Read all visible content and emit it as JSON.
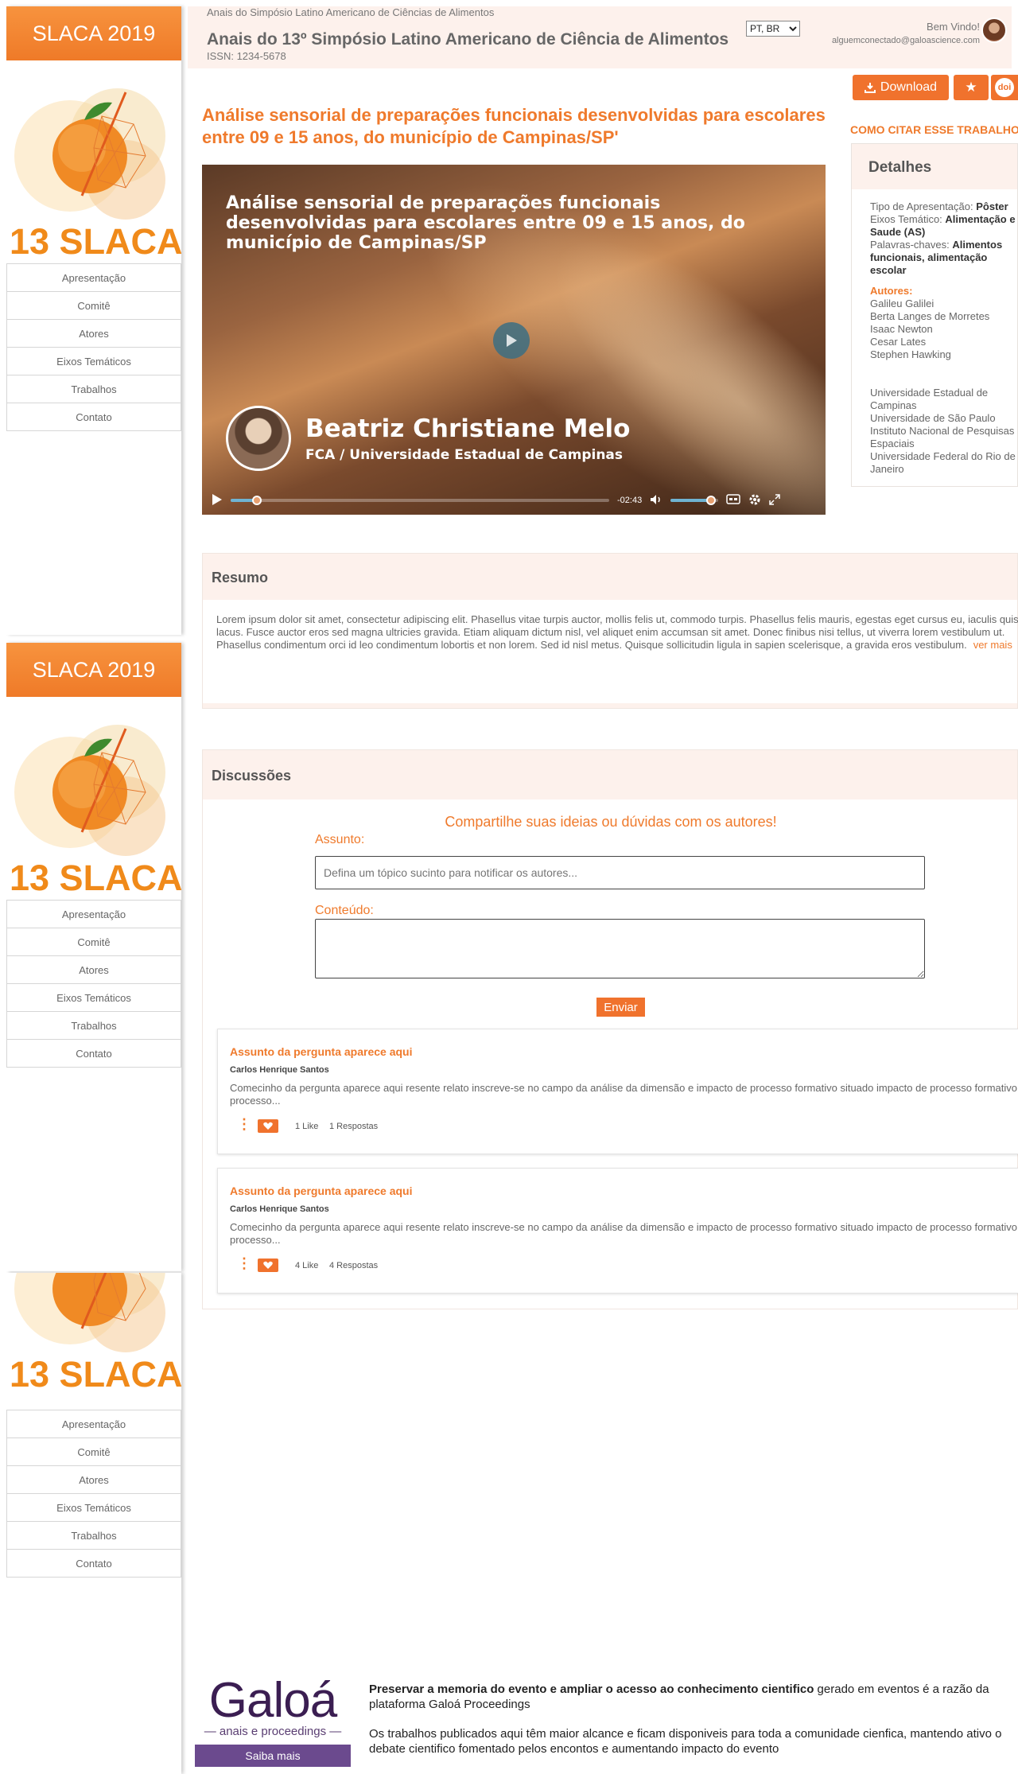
{
  "sidebar": {
    "title": "SLACA 2019",
    "logo_text": "13 SLACA",
    "items": [
      "Apresentação",
      "Comitê",
      "Atores",
      "Eixos Temáticos",
      "Trabalhos",
      "Contato"
    ]
  },
  "header": {
    "subtitle": "Anais do Simpósio Latino Americano de Ciências de Alimentos",
    "title": "Anais do 13º Simpósio Latino Americano de Ciência de Alimentos",
    "issn": "ISSN: 1234-5678",
    "language": "PT, BR",
    "welcome": "Bem Vindo!",
    "email": "alguemconectado@galoascience.com"
  },
  "actions": {
    "download": "Download",
    "doi": "doi"
  },
  "paper": {
    "title": "Análise sensorial de preparações funcionais desenvolvidas para escolares entre 09 e 15 anos, do município de Campinas/SP'",
    "video_title": "Análise sensorial de preparações funcionais desenvolvidas para escolares entre 09 e 15 anos, do município de Campinas/SP",
    "speaker_name": "Beatriz Christiane Melo",
    "speaker_inst": "FCA / Universidade Estadual de Campinas",
    "time_remaining": "-02:43",
    "progress": 0.07,
    "volume": 0.85
  },
  "details": {
    "cite": "COMO CITAR ESSE TRABALHO?",
    "heading": "Detalhes",
    "tipo_label": "Tipo de Apresentação:",
    "tipo_value": "Pôster",
    "eixos_label": "Eixos Temático:",
    "eixos_value": "Alimentação e Saude (AS)",
    "palavras_label": "Palavras-chaves:",
    "palavras_value": "Alimentos funcionais, alimentação escolar",
    "autores_label": "Autores:",
    "autores": [
      "Galileu Galilei",
      "Berta Langes de Morretes",
      "Isaac Newton",
      "Cesar Lates",
      "Stephen Hawking"
    ],
    "instituicoes": [
      "Universidade Estadual de Campinas",
      "Universidade de São Paulo",
      "Instituto Nacional de Pesquisas Espaciais",
      "Universidade Federal do Rio de Janeiro"
    ]
  },
  "resumo": {
    "heading": "Resumo",
    "text": "Lorem ipsum dolor sit amet, consectetur adipiscing elit. Phasellus vitae turpis auctor, mollis felis ut, commodo turpis. Phasellus felis mauris, egestas eget cursus eu, iaculis quis lacus. Fusce auctor eros sed magna ultricies gravida. Etiam aliquam dictum nisl, vel aliquet enim accumsan sit amet. Donec finibus nisi tellus, ut viverra lorem vestibulum ut. Phasellus condimentum orci id leo condimentum lobortis et non lorem. Sed id nisl metus. Quisque sollicitudin ligula in sapien scelerisque, a gravida eros vestibulum.",
    "more": "ver mais"
  },
  "discussoes": {
    "heading": "Discussões",
    "share": "Compartilhe suas ideias ou dúvidas com os autores!",
    "assunto_label": "Assunto:",
    "assunto_placeholder": "Defina um tópico sucinto para notificar os autores...",
    "conteudo_label": "Conteúdo:",
    "send": "Enviar",
    "questions": [
      {
        "subject": "Assunto da pergunta aparece aqui",
        "author": "Carlos Henrique Santos",
        "text": "Comecinho da pergunta aparece aqui resente relato inscreve-se no campo da análise da dimensão e impacto de processo formativo situado impacto de processo formativo processo...",
        "likes": "1 Like",
        "replies": "1 Respostas"
      },
      {
        "subject": "Assunto da pergunta aparece aqui",
        "author": "Carlos Henrique Santos",
        "text": "Comecinho da pergunta aparece aqui resente relato inscreve-se no campo da análise da dimensão e impacto de processo formativo situado impacto de processo formativo processo...",
        "likes": "4 Like",
        "replies": "4 Respostas"
      }
    ]
  },
  "footer": {
    "brand": "Galoá",
    "brand_sub": "anais e proceedings",
    "button": "Saiba mais",
    "p1_bold": "Preservar a memoria do evento e ampliar o acesso ao conhecimento cientifico",
    "p1_rest": " gerado em eventos é a razão da plataforma Galoá Proceedings",
    "p2": "Os trabalhos publicados aqui têm maior alcance e ficam disponiveis para toda a comunidade cienfica, mantendo ativo o debate cientifico fomentado pelos encontos e aumentando impacto do evento"
  },
  "colors": {
    "accent": "#ef7a2c",
    "header_bg": "#fdf1ec",
    "brand_purple": "#3b1e52"
  }
}
